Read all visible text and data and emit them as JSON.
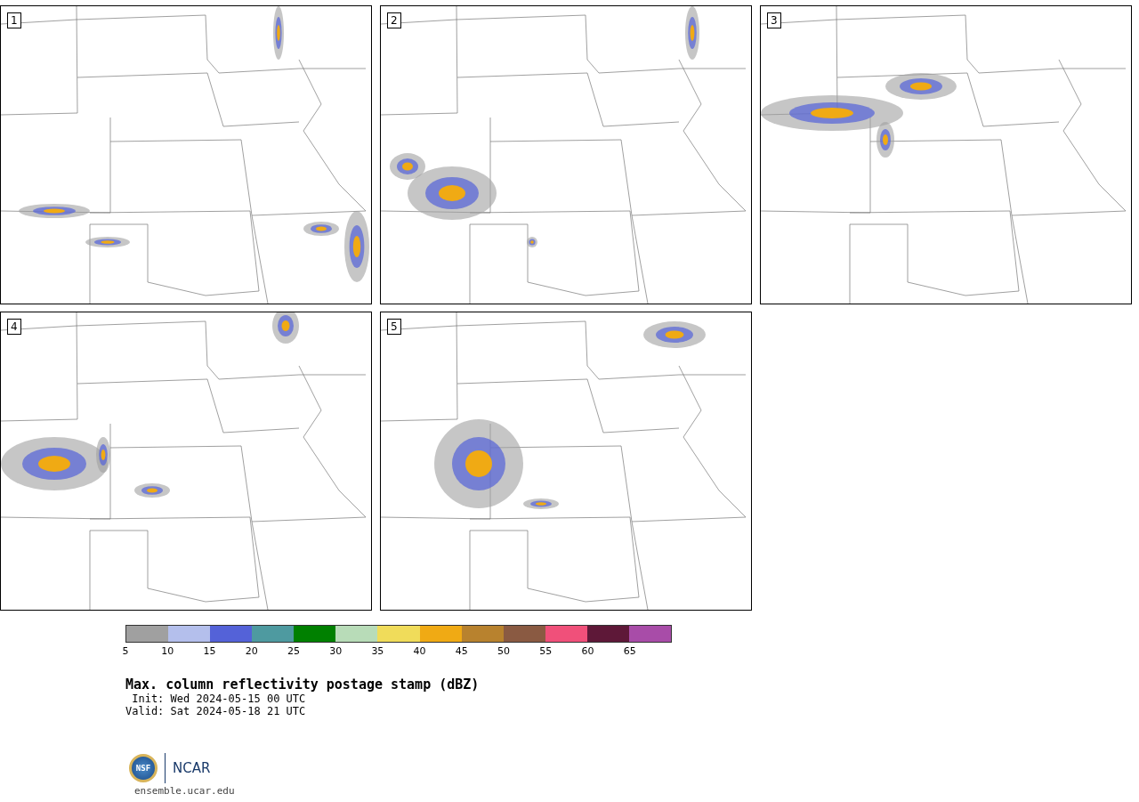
{
  "panels": [
    {
      "label": "1"
    },
    {
      "label": "2"
    },
    {
      "label": "3"
    },
    {
      "label": "4"
    },
    {
      "label": "5"
    }
  ],
  "colorbar": {
    "segments": [
      {
        "color": "#a0a0a0"
      },
      {
        "color": "#b4bfec"
      },
      {
        "color": "#5462d8"
      },
      {
        "color": "#4e9aa0"
      },
      {
        "color": "#008000"
      },
      {
        "color": "#b8dcb8"
      },
      {
        "color": "#f0dc5a"
      },
      {
        "color": "#f0aa14"
      },
      {
        "color": "#b8822e"
      },
      {
        "color": "#8a5a42"
      },
      {
        "color": "#f0507a"
      },
      {
        "color": "#5e1838"
      },
      {
        "color": "#a84ca8"
      }
    ],
    "ticks": [
      "5",
      "10",
      "15",
      "20",
      "25",
      "30",
      "35",
      "40",
      "45",
      "50",
      "55",
      "60",
      "65"
    ]
  },
  "title": "Max. column reflectivity postage stamp (dBZ)",
  "init": " Init: Wed 2024-05-15 00 UTC",
  "valid": "Valid: Sat 2024-05-18 21 UTC",
  "logos": {
    "nsf": "NSF",
    "ncar": "NCAR"
  },
  "url": "ensemble.ucar.edu"
}
